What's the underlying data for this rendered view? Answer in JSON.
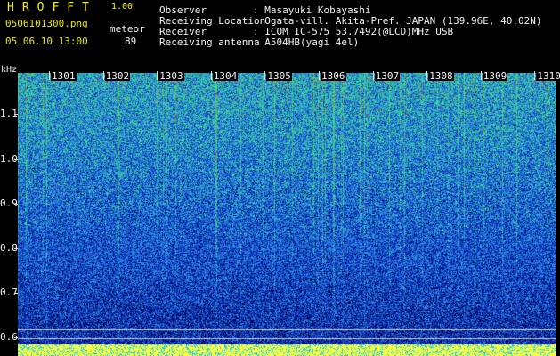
{
  "header": {
    "brand": "HROFFT",
    "version": "1.00",
    "filename": "0506101300.png",
    "datetime": "05.06.10 13:00",
    "meteor_label": "meteor",
    "meteor_count": "89",
    "info": [
      {
        "label": "Observer",
        "value": ": Masayuki Kobayashi"
      },
      {
        "label": "Receiving Location",
        "value": ": Ogata-vill. Akita-Pref. JAPAN (139.96E, 40.02N)"
      },
      {
        "label": "Receiver",
        "value": ": ICOM IC-575 53.7492(@LCD)MHz USB"
      },
      {
        "label": "Receiving antenna",
        "value": ": A504HB(yagi 4el)"
      }
    ]
  },
  "spectrogram": {
    "unit": "kHz",
    "y_ticks": [
      "1.1",
      "1.0",
      "0.9",
      "0.8",
      "0.7",
      "0.6"
    ],
    "x_ticks": [
      "1301",
      "1302",
      "1303",
      "1304",
      "1305",
      "1306",
      "1307",
      "1308",
      "1309",
      "1310"
    ],
    "colors": {
      "background": "#000000",
      "low": "#0a1a8c",
      "mid": "#2a7ad8",
      "high": "#3fd08a",
      "peak": "#e83a30",
      "baseline": "#ffff33"
    }
  }
}
